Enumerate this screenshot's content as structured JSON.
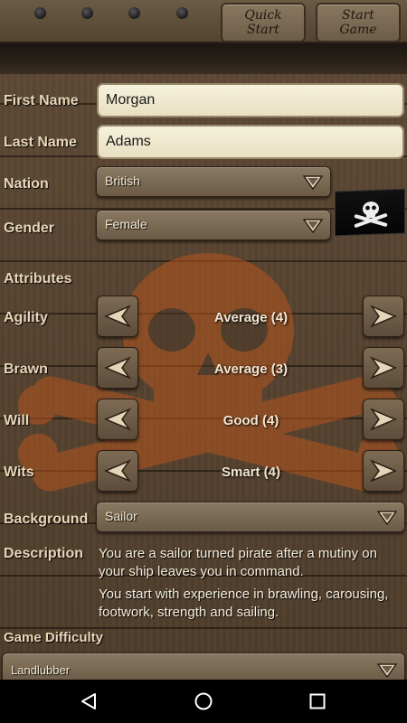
{
  "toolbar": {
    "quick_start_label": "Quick Start",
    "start_game_label": "Start Game"
  },
  "form": {
    "first_name": {
      "label": "First Name",
      "value": "Morgan"
    },
    "last_name": {
      "label": "Last Name",
      "value": "Adams"
    },
    "nation": {
      "label": "Nation",
      "selected": "British"
    },
    "gender": {
      "label": "Gender",
      "selected": "Female"
    }
  },
  "attributes": {
    "heading": "Attributes",
    "items": [
      {
        "label": "Agility",
        "value": "Average (4)"
      },
      {
        "label": "Brawn",
        "value": "Average (3)"
      },
      {
        "label": "Will",
        "value": "Good (4)"
      },
      {
        "label": "Wits",
        "value": "Smart (4)"
      }
    ]
  },
  "background": {
    "label": "Background",
    "selected": "Sailor"
  },
  "description": {
    "label": "Description",
    "paragraph1": "You are a sailor turned pirate after a mutiny on your ship leaves you in command.",
    "paragraph2": "You start with experience in brawling, carousing, footwork, strength and sailing."
  },
  "difficulty": {
    "label": "Game Difficulty",
    "selected": "Landlubber"
  },
  "icons": {
    "flag": "jolly-roger-flag-icon",
    "prev": "left-arrow-icon",
    "next": "right-arrow-icon",
    "dropdown": "dropdown-chevron-icon",
    "nav_back": "back-icon",
    "nav_home": "home-icon",
    "nav_recents": "recents-icon"
  },
  "colors": {
    "label": "#e9d6b8",
    "wood": "#574330",
    "field": "#f6f1dc"
  }
}
